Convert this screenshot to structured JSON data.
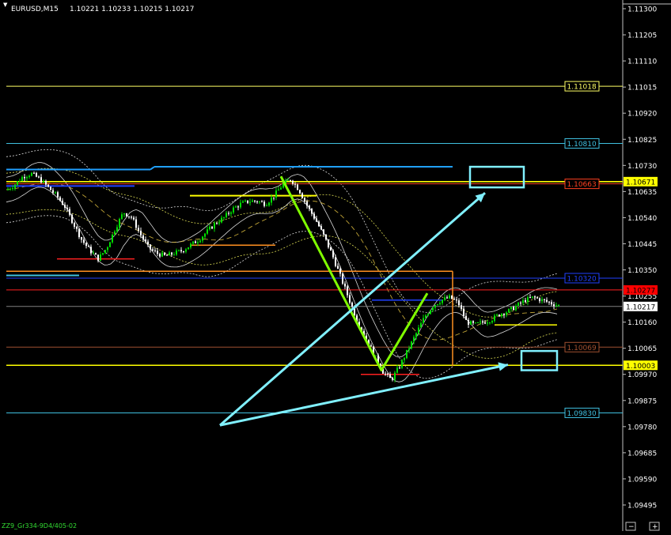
{
  "window": {
    "symbol": "EURUSD,M15",
    "ohlc": "1.10221 1.10233 1.10215 1.10217",
    "footer": "ZZ9_Gr334-9D4/405-02",
    "zoom_marks": [
      "−",
      "+"
    ]
  },
  "chart_data": {
    "type": "line",
    "title": "EURUSD,M15",
    "y_ticks": [
      "1.11300",
      "1.11205",
      "1.11110",
      "1.11015",
      "1.10920",
      "1.10825",
      "1.10730",
      "1.10635",
      "1.10540",
      "1.10445",
      "1.10350",
      "1.10255",
      "1.10160",
      "1.10065",
      "1.09970",
      "1.09875",
      "1.09780",
      "1.09685",
      "1.09590",
      "1.09495"
    ],
    "ylim": [
      1.0942,
      1.1133
    ],
    "grid": false,
    "colors": {
      "bull_candle": "#00e000",
      "bear_candle": "#ffffff",
      "zigzag": "#80ff00",
      "arrows": "#80f0ff",
      "level_yellow": "#ffff00",
      "level_cyan": "#40c0e0",
      "level_blue": "#2040ff",
      "level_red": "#ff2020",
      "level_orange": "#ff9020"
    },
    "levels": [
      {
        "name": "yellow-upper",
        "value": 1.11018,
        "label": "1.11018",
        "color": "#ffff66",
        "dash": false
      },
      {
        "name": "cyan-upper",
        "value": 1.1081,
        "label": "1.10810",
        "color": "#40c0e0",
        "dash": false
      },
      {
        "name": "yellow-thick",
        "value": 1.10671,
        "label": "1.10671",
        "color": "#ffff00",
        "dash": false
      },
      {
        "name": "red-mid",
        "value": 1.10663,
        "label": "1.10663",
        "color": "#ff4020",
        "dash": false
      },
      {
        "name": "blue-mid",
        "value": 1.1032,
        "label": "1.10320",
        "color": "#2040ff",
        "dash": false
      },
      {
        "name": "red-current",
        "value": 1.10277,
        "label": "1.10277",
        "color": "#ff2020",
        "dash": false
      },
      {
        "name": "bid",
        "value": 1.10217,
        "label": "1.10217",
        "color": "#808080",
        "dash": false
      },
      {
        "name": "brown-lower",
        "value": 1.10069,
        "label": "1.10069",
        "color": "#a05030",
        "dash": false
      },
      {
        "name": "yellow-lower",
        "value": 1.10003,
        "label": "1.10003",
        "color": "#ffff00",
        "dash": false
      },
      {
        "name": "cyan-lower",
        "value": 1.0983,
        "label": "1.09830",
        "color": "#40c0e0",
        "dash": false
      }
    ],
    "price_path": [
      1.1064,
      1.1066,
      1.1069,
      1.107,
      1.1068,
      1.1065,
      1.1062,
      1.1058,
      1.1052,
      1.1046,
      1.1042,
      1.1039,
      1.1043,
      1.105,
      1.1056,
      1.1054,
      1.1048,
      1.1043,
      1.1041,
      1.104,
      1.1041,
      1.1042,
      1.1044,
      1.1046,
      1.1049,
      1.1052,
      1.1054,
      1.1057,
      1.1059,
      1.106,
      1.106,
      1.1059,
      1.1062,
      1.1066,
      1.1068,
      1.1064,
      1.1058,
      1.1053,
      1.1047,
      1.104,
      1.1032,
      1.1024,
      1.1016,
      1.101,
      1.1004,
      1.0998,
      1.0995,
      1.1,
      1.1006,
      1.1012,
      1.1018,
      1.1022,
      1.1024,
      1.1025,
      1.1023,
      1.1016,
      1.1015,
      1.1016,
      1.1017,
      1.1019,
      1.102,
      1.1022,
      1.1024,
      1.1025,
      1.1024,
      1.1023,
      1.1022
    ]
  }
}
